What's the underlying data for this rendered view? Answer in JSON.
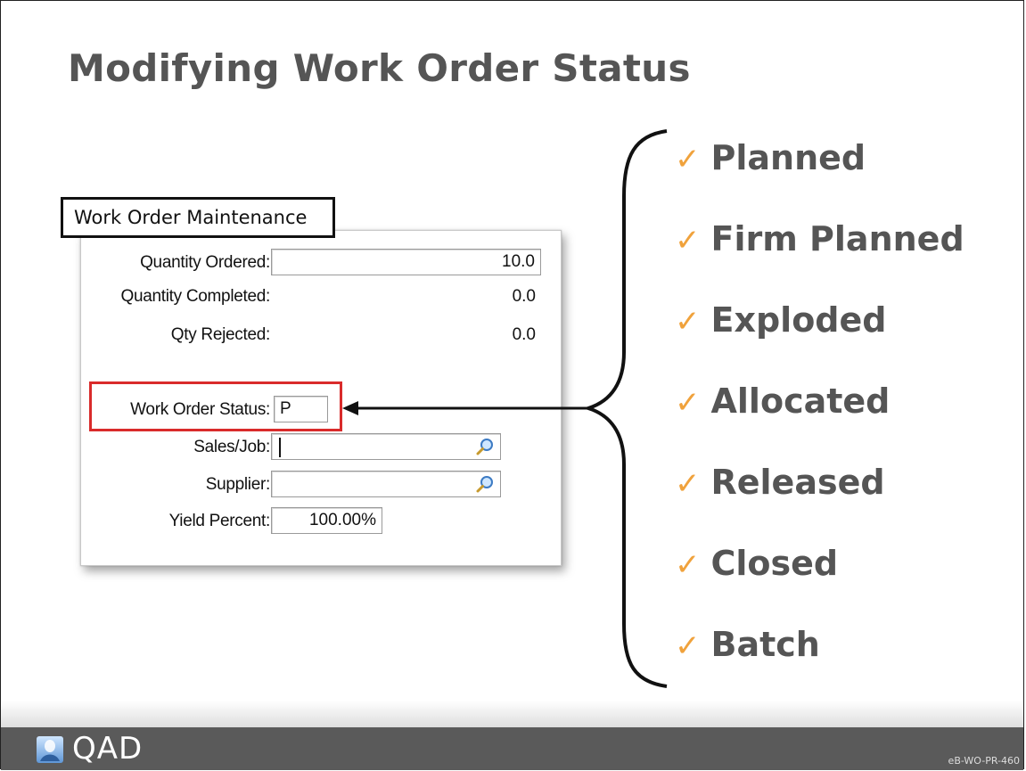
{
  "slide": {
    "title": "Modifying Work Order Status",
    "dialog_title": "Work Order Maintenance",
    "footer_logo": "QAD",
    "footer_code": "eB-WO-PR-460"
  },
  "form": {
    "quantity_ordered": {
      "label": "Quantity Ordered:",
      "value": "10.0"
    },
    "quantity_completed": {
      "label": "Quantity Completed:",
      "value": "0.0"
    },
    "qty_rejected": {
      "label": "Qty Rejected:",
      "value": "0.0"
    },
    "work_order_status": {
      "label": "Work Order Status:",
      "value": "P"
    },
    "sales_job": {
      "label": "Sales/Job:",
      "value": ""
    },
    "supplier": {
      "label": "Supplier:",
      "value": ""
    },
    "yield_percent": {
      "label": "Yield Percent:",
      "value": "100.00%"
    }
  },
  "statuses": [
    "Planned",
    "Firm Planned",
    "Exploded",
    "Allocated",
    "Released",
    "Closed",
    "Batch"
  ],
  "icons": {
    "check": "check-icon",
    "lookup": "magnifier-icon",
    "logo": "qad-logo-icon"
  },
  "colors": {
    "highlight": "#d92b2b",
    "check": "#f0a23c",
    "text": "#555555"
  }
}
